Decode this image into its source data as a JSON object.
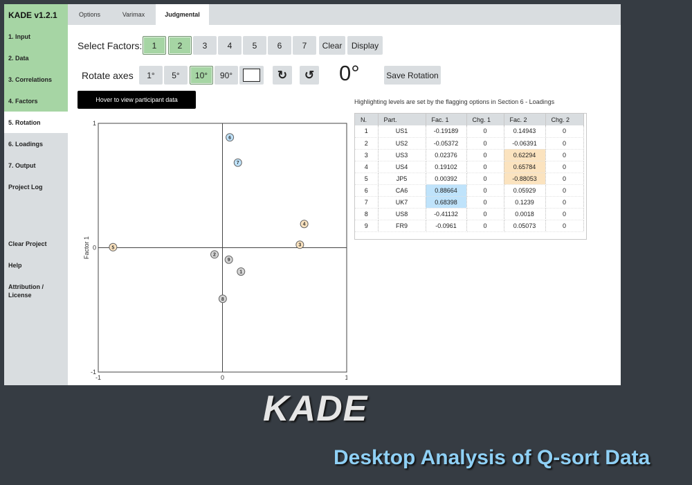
{
  "app": {
    "title": "KADE v1.2.1"
  },
  "sidebar": {
    "items": [
      {
        "label": "1. Input"
      },
      {
        "label": "2. Data"
      },
      {
        "label": "3. Correlations"
      },
      {
        "label": "4. Factors"
      },
      {
        "label": "5. Rotation"
      },
      {
        "label": "6. Loadings"
      },
      {
        "label": "7. Output"
      },
      {
        "label": "Project Log"
      }
    ],
    "bottom": [
      {
        "label": "Clear Project"
      },
      {
        "label": "Help"
      },
      {
        "label": "Attribution / License"
      }
    ]
  },
  "tabs": [
    {
      "label": "Options"
    },
    {
      "label": "Varimax"
    },
    {
      "label": "Judgmental"
    }
  ],
  "select_factors": {
    "label": "Select Factors:",
    "buttons": [
      "1",
      "2",
      "3",
      "4",
      "5",
      "6",
      "7"
    ],
    "selected": [
      "1",
      "2"
    ],
    "clear_label": "Clear",
    "display_label": "Display"
  },
  "rotate": {
    "label": "Rotate axes",
    "steps": [
      "1°",
      "5°",
      "10°",
      "90°"
    ],
    "selected_step": "10°",
    "input_value": "",
    "cw_glyph": "↻",
    "ccw_glyph": "↺",
    "angle": "0°",
    "save_label": "Save Rotation"
  },
  "hover_label": "Hover to view participant data",
  "note": "Highlighting levels are set by the flagging options in Section 6 - Loadings",
  "table": {
    "headers": [
      "N.",
      "Part.",
      "Fac. 1",
      "Chg. 1",
      "Fac. 2",
      "Chg. 2"
    ],
    "rows": [
      [
        "1",
        "US1",
        "-0.19189",
        "0",
        "0.14943",
        "0"
      ],
      [
        "2",
        "US2",
        "-0.05372",
        "0",
        "-0.06391",
        "0"
      ],
      [
        "3",
        "US3",
        "0.02376",
        "0",
        "0.62294",
        "0"
      ],
      [
        "4",
        "US4",
        "0.19102",
        "0",
        "0.65784",
        "0"
      ],
      [
        "5",
        "JP5",
        "0.00392",
        "0",
        "-0.88053",
        "0"
      ],
      [
        "6",
        "CA6",
        "0.88664",
        "0",
        "0.05929",
        "0"
      ],
      [
        "7",
        "UK7",
        "0.68398",
        "0",
        "0.1239",
        "0"
      ],
      [
        "8",
        "US8",
        "-0.41132",
        "0",
        "0.0018",
        "0"
      ],
      [
        "9",
        "FR9",
        "-0.0961",
        "0",
        "0.05073",
        "0"
      ]
    ],
    "highlight": {
      "blue": [
        [
          5,
          2
        ],
        [
          6,
          2
        ]
      ],
      "orange": [
        [
          2,
          4
        ],
        [
          3,
          4
        ],
        [
          4,
          4
        ]
      ]
    }
  },
  "colors": {
    "flag_factor1": "#bfe3fb",
    "flag_factor2": "#fbe3bf",
    "unflagged": "#d4d4d4",
    "selected_green": "#a6d5a4"
  },
  "chart_data": {
    "type": "scatter",
    "ylabel": "Factor 1",
    "xlabel": "",
    "xlim": [
      -1,
      1
    ],
    "ylim": [
      -1,
      1
    ],
    "xticks": [
      "-1",
      "0",
      "1"
    ],
    "yticks": [
      "-1",
      "0",
      "1"
    ],
    "points": [
      {
        "label": "1",
        "x": 0.149,
        "y": -0.192,
        "group": "unflagged"
      },
      {
        "label": "2",
        "x": -0.064,
        "y": -0.054,
        "group": "unflagged"
      },
      {
        "label": "3",
        "x": 0.623,
        "y": 0.024,
        "group": "factor2"
      },
      {
        "label": "4",
        "x": 0.658,
        "y": 0.191,
        "group": "factor2"
      },
      {
        "label": "5",
        "x": -0.881,
        "y": 0.004,
        "group": "factor2"
      },
      {
        "label": "6",
        "x": 0.059,
        "y": 0.887,
        "group": "factor1"
      },
      {
        "label": "7",
        "x": 0.124,
        "y": 0.684,
        "group": "factor1"
      },
      {
        "label": "8",
        "x": 0.002,
        "y": -0.411,
        "group": "unflagged"
      },
      {
        "label": "9",
        "x": 0.051,
        "y": -0.096,
        "group": "unflagged"
      }
    ]
  },
  "branding": {
    "name": "KADE",
    "tagline": "Desktop Analysis of Q-sort Data"
  }
}
